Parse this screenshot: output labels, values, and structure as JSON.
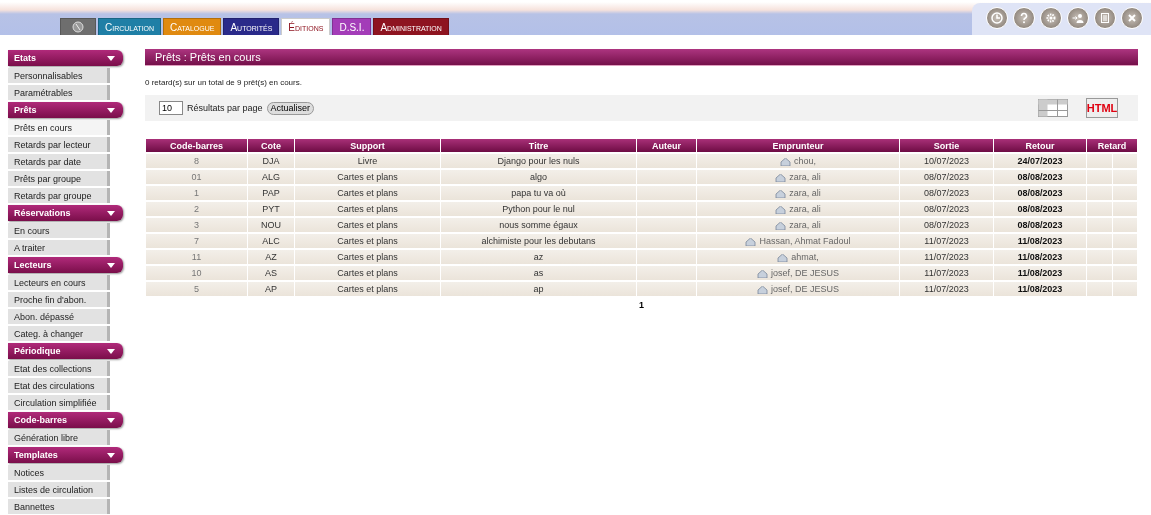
{
  "tabs": [
    {
      "kind": "icon",
      "color": "#6e6e6e",
      "selected": false
    },
    {
      "kind": "text",
      "label": "Circulation",
      "color": "#1f7fa6",
      "selected": false
    },
    {
      "kind": "text",
      "label": "Catalogue",
      "color": "#e08a10",
      "selected": false
    },
    {
      "kind": "text",
      "label": "Autorités",
      "color": "#2a2a8a",
      "selected": false
    },
    {
      "kind": "text",
      "label": "Éditions",
      "color": "#ffffff",
      "selected": true
    },
    {
      "kind": "text",
      "label": "D.S.I.",
      "color": "#a33cb8",
      "selected": false
    },
    {
      "kind": "text",
      "label": "Administration",
      "color": "#8e1420",
      "selected": false
    }
  ],
  "toolbar": [
    {
      "kind": "clock"
    },
    {
      "kind": "help"
    },
    {
      "kind": "settings"
    },
    {
      "kind": "user"
    },
    {
      "kind": "save"
    },
    {
      "kind": "close"
    }
  ],
  "sidebar": [
    {
      "title": "Etats",
      "items": [
        {
          "label": "Personnalisables",
          "selected": false
        },
        {
          "label": "Paramétrables",
          "selected": false
        }
      ]
    },
    {
      "title": "Prêts",
      "items": [
        {
          "label": "Prêts en cours",
          "selected": true
        },
        {
          "label": "Retards par lecteur",
          "selected": false
        },
        {
          "label": "Retards par date",
          "selected": false
        },
        {
          "label": "Prêts par groupe",
          "selected": false
        },
        {
          "label": "Retards par groupe",
          "selected": false
        }
      ]
    },
    {
      "title": "Réservations",
      "items": [
        {
          "label": "En cours",
          "selected": false
        },
        {
          "label": "A traiter",
          "selected": false
        }
      ]
    },
    {
      "title": "Lecteurs",
      "items": [
        {
          "label": "Lecteurs en cours",
          "selected": false
        },
        {
          "label": "Proche fin d'abon.",
          "selected": false
        },
        {
          "label": "Abon. dépassé",
          "selected": false
        },
        {
          "label": "Categ. à changer",
          "selected": false
        }
      ]
    },
    {
      "title": "Périodique",
      "items": [
        {
          "label": "Etat des collections",
          "selected": false
        },
        {
          "label": "Etat des circulations",
          "selected": false
        },
        {
          "label": "Circulation simplifiée",
          "selected": false
        }
      ]
    },
    {
      "title": "Code-barres",
      "items": [
        {
          "label": "Génération libre",
          "selected": false
        }
      ]
    },
    {
      "title": "Templates",
      "items": [
        {
          "label": "Notices",
          "selected": false
        },
        {
          "label": "Listes de circulation",
          "selected": false
        },
        {
          "label": "Bannettes",
          "selected": false
        }
      ]
    }
  ],
  "page_title": "Prêts : Prêts en cours",
  "summary": "0 retard(s) sur un total de 9 prêt(s) en cours.",
  "per_page": {
    "value": "10",
    "label": "Résultats par page",
    "button": "Actualiser"
  },
  "export": {
    "html_label": "HTML"
  },
  "table": {
    "columns": [
      "Code-barres",
      "Cote",
      "Support",
      "Titre",
      "Auteur",
      "Emprunteur",
      "Sortie",
      "Retour",
      "Retard"
    ],
    "rows": [
      {
        "barcode": "8",
        "cote": "DJA",
        "support": "Livre",
        "title": "Django pour les nuls",
        "borrower": "chou,",
        "out": "10/07/2023",
        "due": "24/07/2023"
      },
      {
        "barcode": "01",
        "cote": "ALG",
        "support": "Cartes et plans",
        "title": "algo",
        "borrower": "zara, ali",
        "out": "08/07/2023",
        "due": "08/08/2023"
      },
      {
        "barcode": "1",
        "cote": "PAP",
        "support": "Cartes et plans",
        "title": "papa tu va où",
        "borrower": "zara, ali",
        "out": "08/07/2023",
        "due": "08/08/2023"
      },
      {
        "barcode": "2",
        "cote": "PYT",
        "support": "Cartes et plans",
        "title": "Python pour le nul",
        "borrower": "zara, ali",
        "out": "08/07/2023",
        "due": "08/08/2023"
      },
      {
        "barcode": "3",
        "cote": "NOU",
        "support": "Cartes et plans",
        "title": "nous somme égaux",
        "borrower": "zara, ali",
        "out": "08/07/2023",
        "due": "08/08/2023"
      },
      {
        "barcode": "7",
        "cote": "ALC",
        "support": "Cartes et plans",
        "title": "alchimiste pour les debutans",
        "borrower": "Hassan, Ahmat Fadoul",
        "out": "11/07/2023",
        "due": "11/08/2023"
      },
      {
        "barcode": "11",
        "cote": "AZ",
        "support": "Cartes et plans",
        "title": "az",
        "borrower": "ahmat,",
        "out": "11/07/2023",
        "due": "11/08/2023"
      },
      {
        "barcode": "10",
        "cote": "AS",
        "support": "Cartes et plans",
        "title": "as",
        "borrower": "josef, DE JESUS",
        "out": "11/07/2023",
        "due": "11/08/2023"
      },
      {
        "barcode": "5",
        "cote": "AP",
        "support": "Cartes et plans",
        "title": "ap",
        "borrower": "josef, DE JESUS",
        "out": "11/07/2023",
        "due": "11/08/2023"
      }
    ]
  },
  "pagination": "1"
}
